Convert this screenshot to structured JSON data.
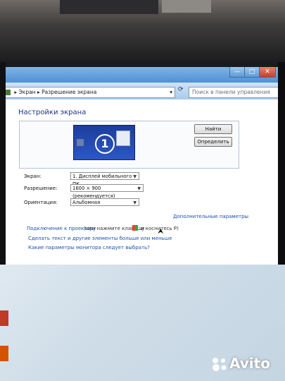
{
  "window": {
    "address_parts": [
      "Экран",
      "Разрешение экрана"
    ],
    "search_placeholder": "Поиск в панели управления",
    "title": "Настройки экрана",
    "monitor_number": "1",
    "buttons": {
      "find": "Найти",
      "identify": "Определить"
    },
    "fields": {
      "screen": {
        "label": "Экран:",
        "value": "1. Дисплей мобильного ПК"
      },
      "resolution": {
        "label": "Разрешение:",
        "value": "1600 × 900 (рекомендуется)"
      },
      "orientation": {
        "label": "Ориентация:",
        "value": "Альбомная"
      }
    },
    "advanced_link": "Дополнительные параметры",
    "projector_link": "Подключение к проектору",
    "projector_hint": "(или нажмите клавишу",
    "projector_hint2": "и коснитесь P)",
    "text_size_link": "Сделать текст и другие элементы больше или меньше",
    "monitor_params_link": "Какие параметры монитора следует выбрать?"
  },
  "watermark": {
    "brand": "Avito"
  }
}
